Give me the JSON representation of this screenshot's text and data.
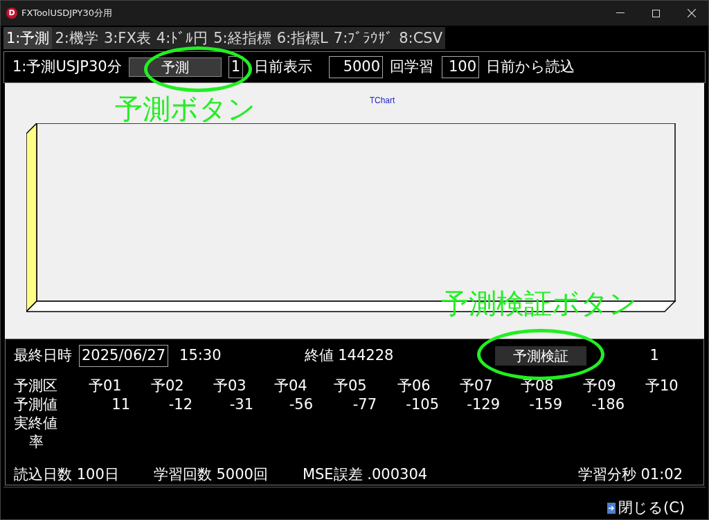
{
  "window": {
    "title": "FXToolUSDJPY30分用",
    "app_letter": "D"
  },
  "tabs": [
    {
      "label": "1:予測",
      "selected": true
    },
    {
      "label": "2:機学",
      "selected": false
    },
    {
      "label": "3:FX表",
      "selected": false
    },
    {
      "label": "4:ﾄﾞﾙ円",
      "selected": false
    },
    {
      "label": "5:経指標",
      "selected": false
    },
    {
      "label": "6:指標L",
      "selected": false
    },
    {
      "label": "7:ﾌﾞﾗｳｻﾞ",
      "selected": false
    },
    {
      "label": "8:CSV",
      "selected": false
    }
  ],
  "toolbar": {
    "title": "1:予測USJP30分",
    "predict_button": "予測",
    "days_display": "1",
    "days_display_label": "日前表示",
    "iterations": "5000",
    "iterations_label": "回学習",
    "load_days": "100",
    "load_days_label": "日前から読込"
  },
  "chart": {
    "title": "TChart"
  },
  "info": {
    "last_date_label": "最終日時",
    "last_date": "2025/06/27",
    "last_time": "15:30",
    "close_value": "終値 144228",
    "verify_button": "予測検証",
    "count": "1"
  },
  "forecast_table": {
    "columns": [
      "予01",
      "予02",
      "予03",
      "予04",
      "予05",
      "予06",
      "予07",
      "予08",
      "予09",
      "予10"
    ],
    "header_label": "予測区",
    "rows": [
      {
        "label": "予測値",
        "values": [
          "11",
          "-12",
          "-31",
          "-56",
          "-77",
          "-105",
          "-129",
          "-159",
          "-186"
        ]
      },
      {
        "label": "実終値",
        "values": []
      },
      {
        "label": "率",
        "values": [],
        "indented": true
      }
    ]
  },
  "stats": [
    "読込日数 100日",
    "学習回数 5000回",
    "MSE誤差 .000304",
    "学習分秒 01:02"
  ],
  "close_button": {
    "label": "閉じる(C)"
  },
  "annotations": [
    {
      "text": "予測ボタン"
    },
    {
      "text": "予測検証ボタン"
    }
  ]
}
